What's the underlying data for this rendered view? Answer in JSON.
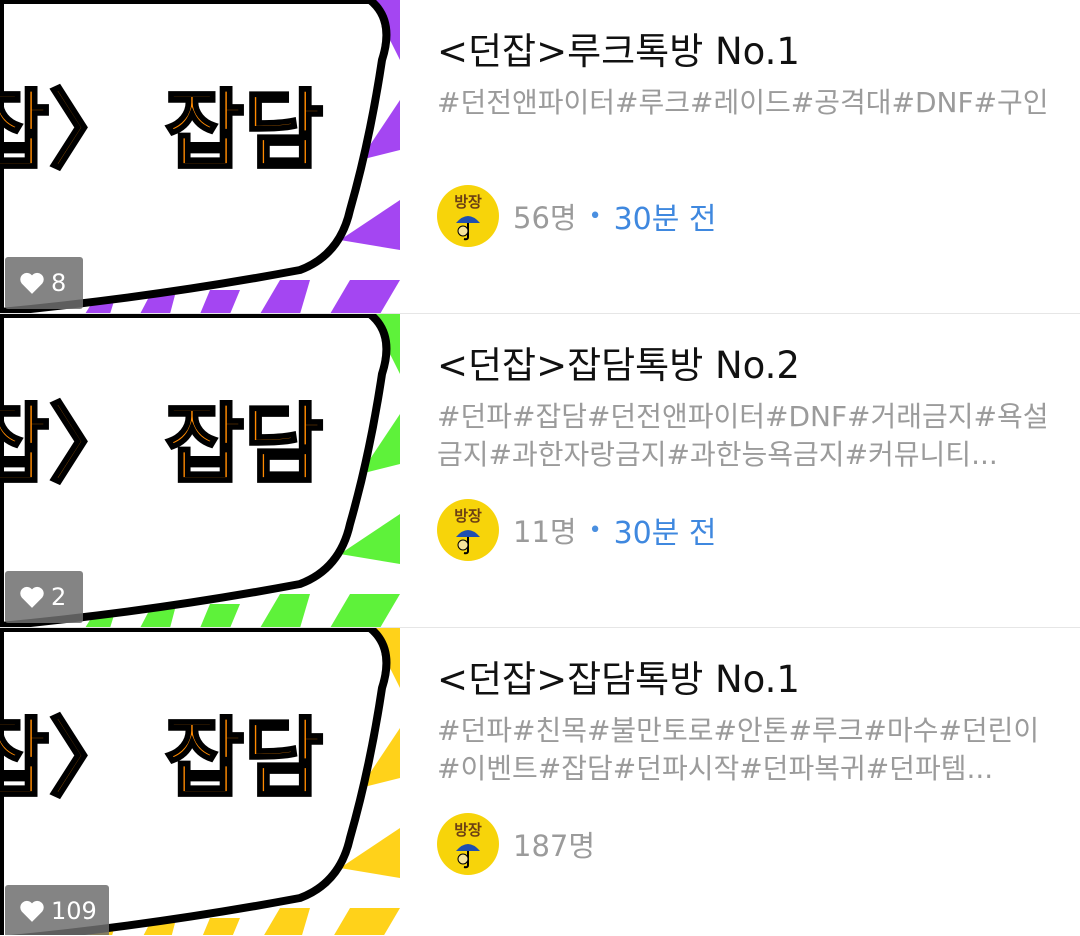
{
  "rooms": [
    {
      "title": "<던잡>루크톡방 No.1",
      "tags": "#던전앤파이터#루크#레이드#공격대#DNF#구인",
      "likes": "8",
      "thumb_text": "잡〉 잡담",
      "thumb_accent": "#a446f2",
      "avatar_text": "방장",
      "members": "56명",
      "time": "30분 전"
    },
    {
      "title": "<던잡>잡담톡방 No.2",
      "tags": "#던파#잡담#던전앤파이터#DNF#거래금지#욕설금지#과한자랑금지#과한능욕금지#커뮤니티...",
      "likes": "2",
      "thumb_text": "잡〉 잡담",
      "thumb_accent": "#5ef23a",
      "avatar_text": "방장",
      "members": "11명",
      "time": "30분 전"
    },
    {
      "title": "<던잡>잡담톡방 No.1",
      "tags": "#던파#친목#불만토로#안톤#루크#마수#던린이#이벤트#잡담#던파시작#던파복귀#던파템...",
      "likes": "109",
      "thumb_text": "잡〉 잡담",
      "thumb_accent": "#ffd21a",
      "avatar_text": "방장",
      "members": "187명",
      "time": ""
    }
  ]
}
